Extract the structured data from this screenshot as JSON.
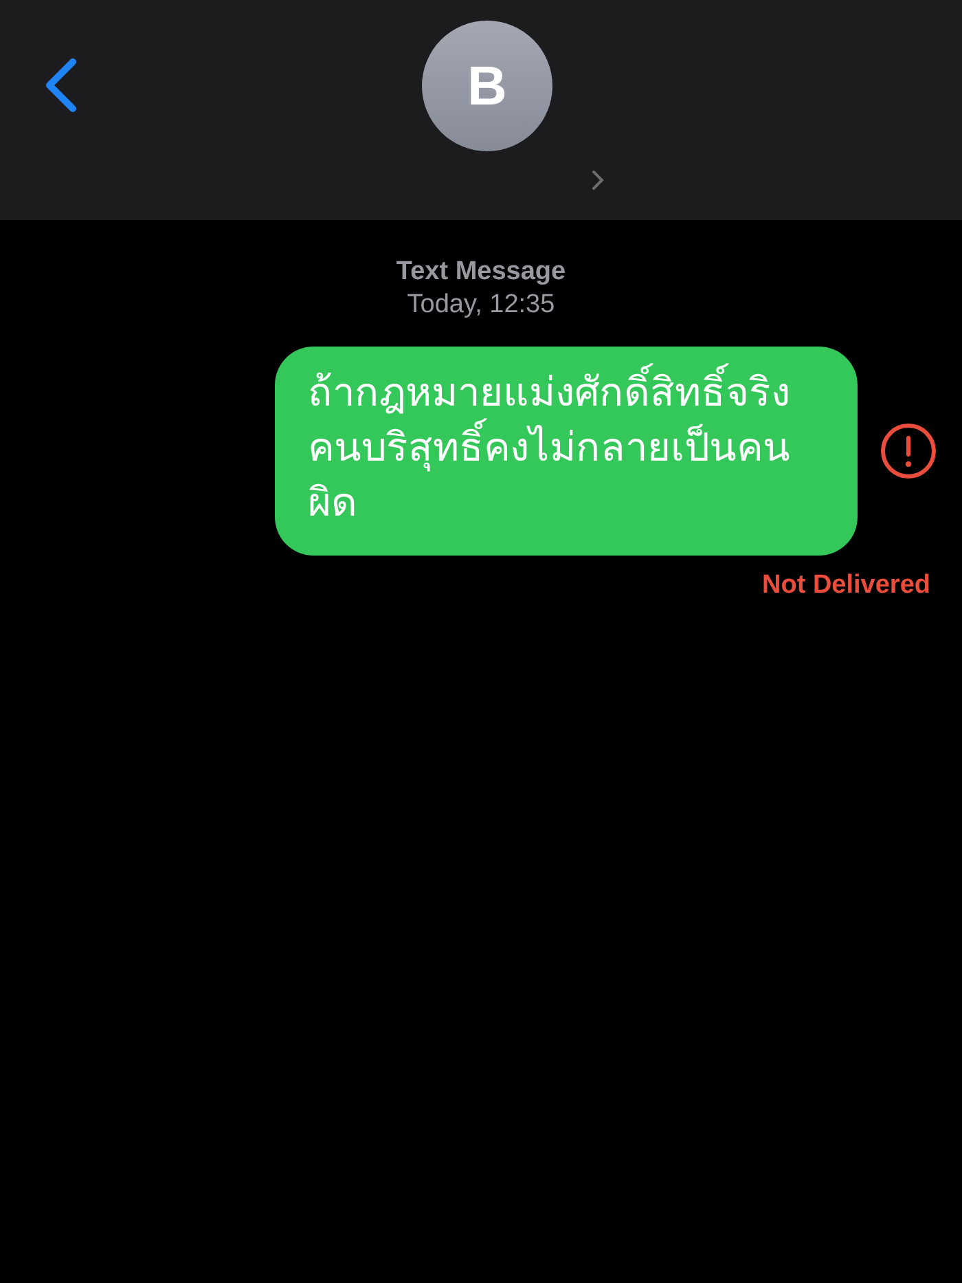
{
  "header": {
    "avatar_letter": "B"
  },
  "thread": {
    "service": "Text Message",
    "timestamp": "Today, 12:35"
  },
  "messages": [
    {
      "kind": "sent",
      "lines": [
        "ถ้ากฎหมายแม่งศักดิ์สิทธิ์จริง",
        "คนบริสุทธิ์คงไม่กลายเป็นคน",
        "ผิด"
      ],
      "failed": true,
      "status": "Not Delivered"
    }
  ]
}
